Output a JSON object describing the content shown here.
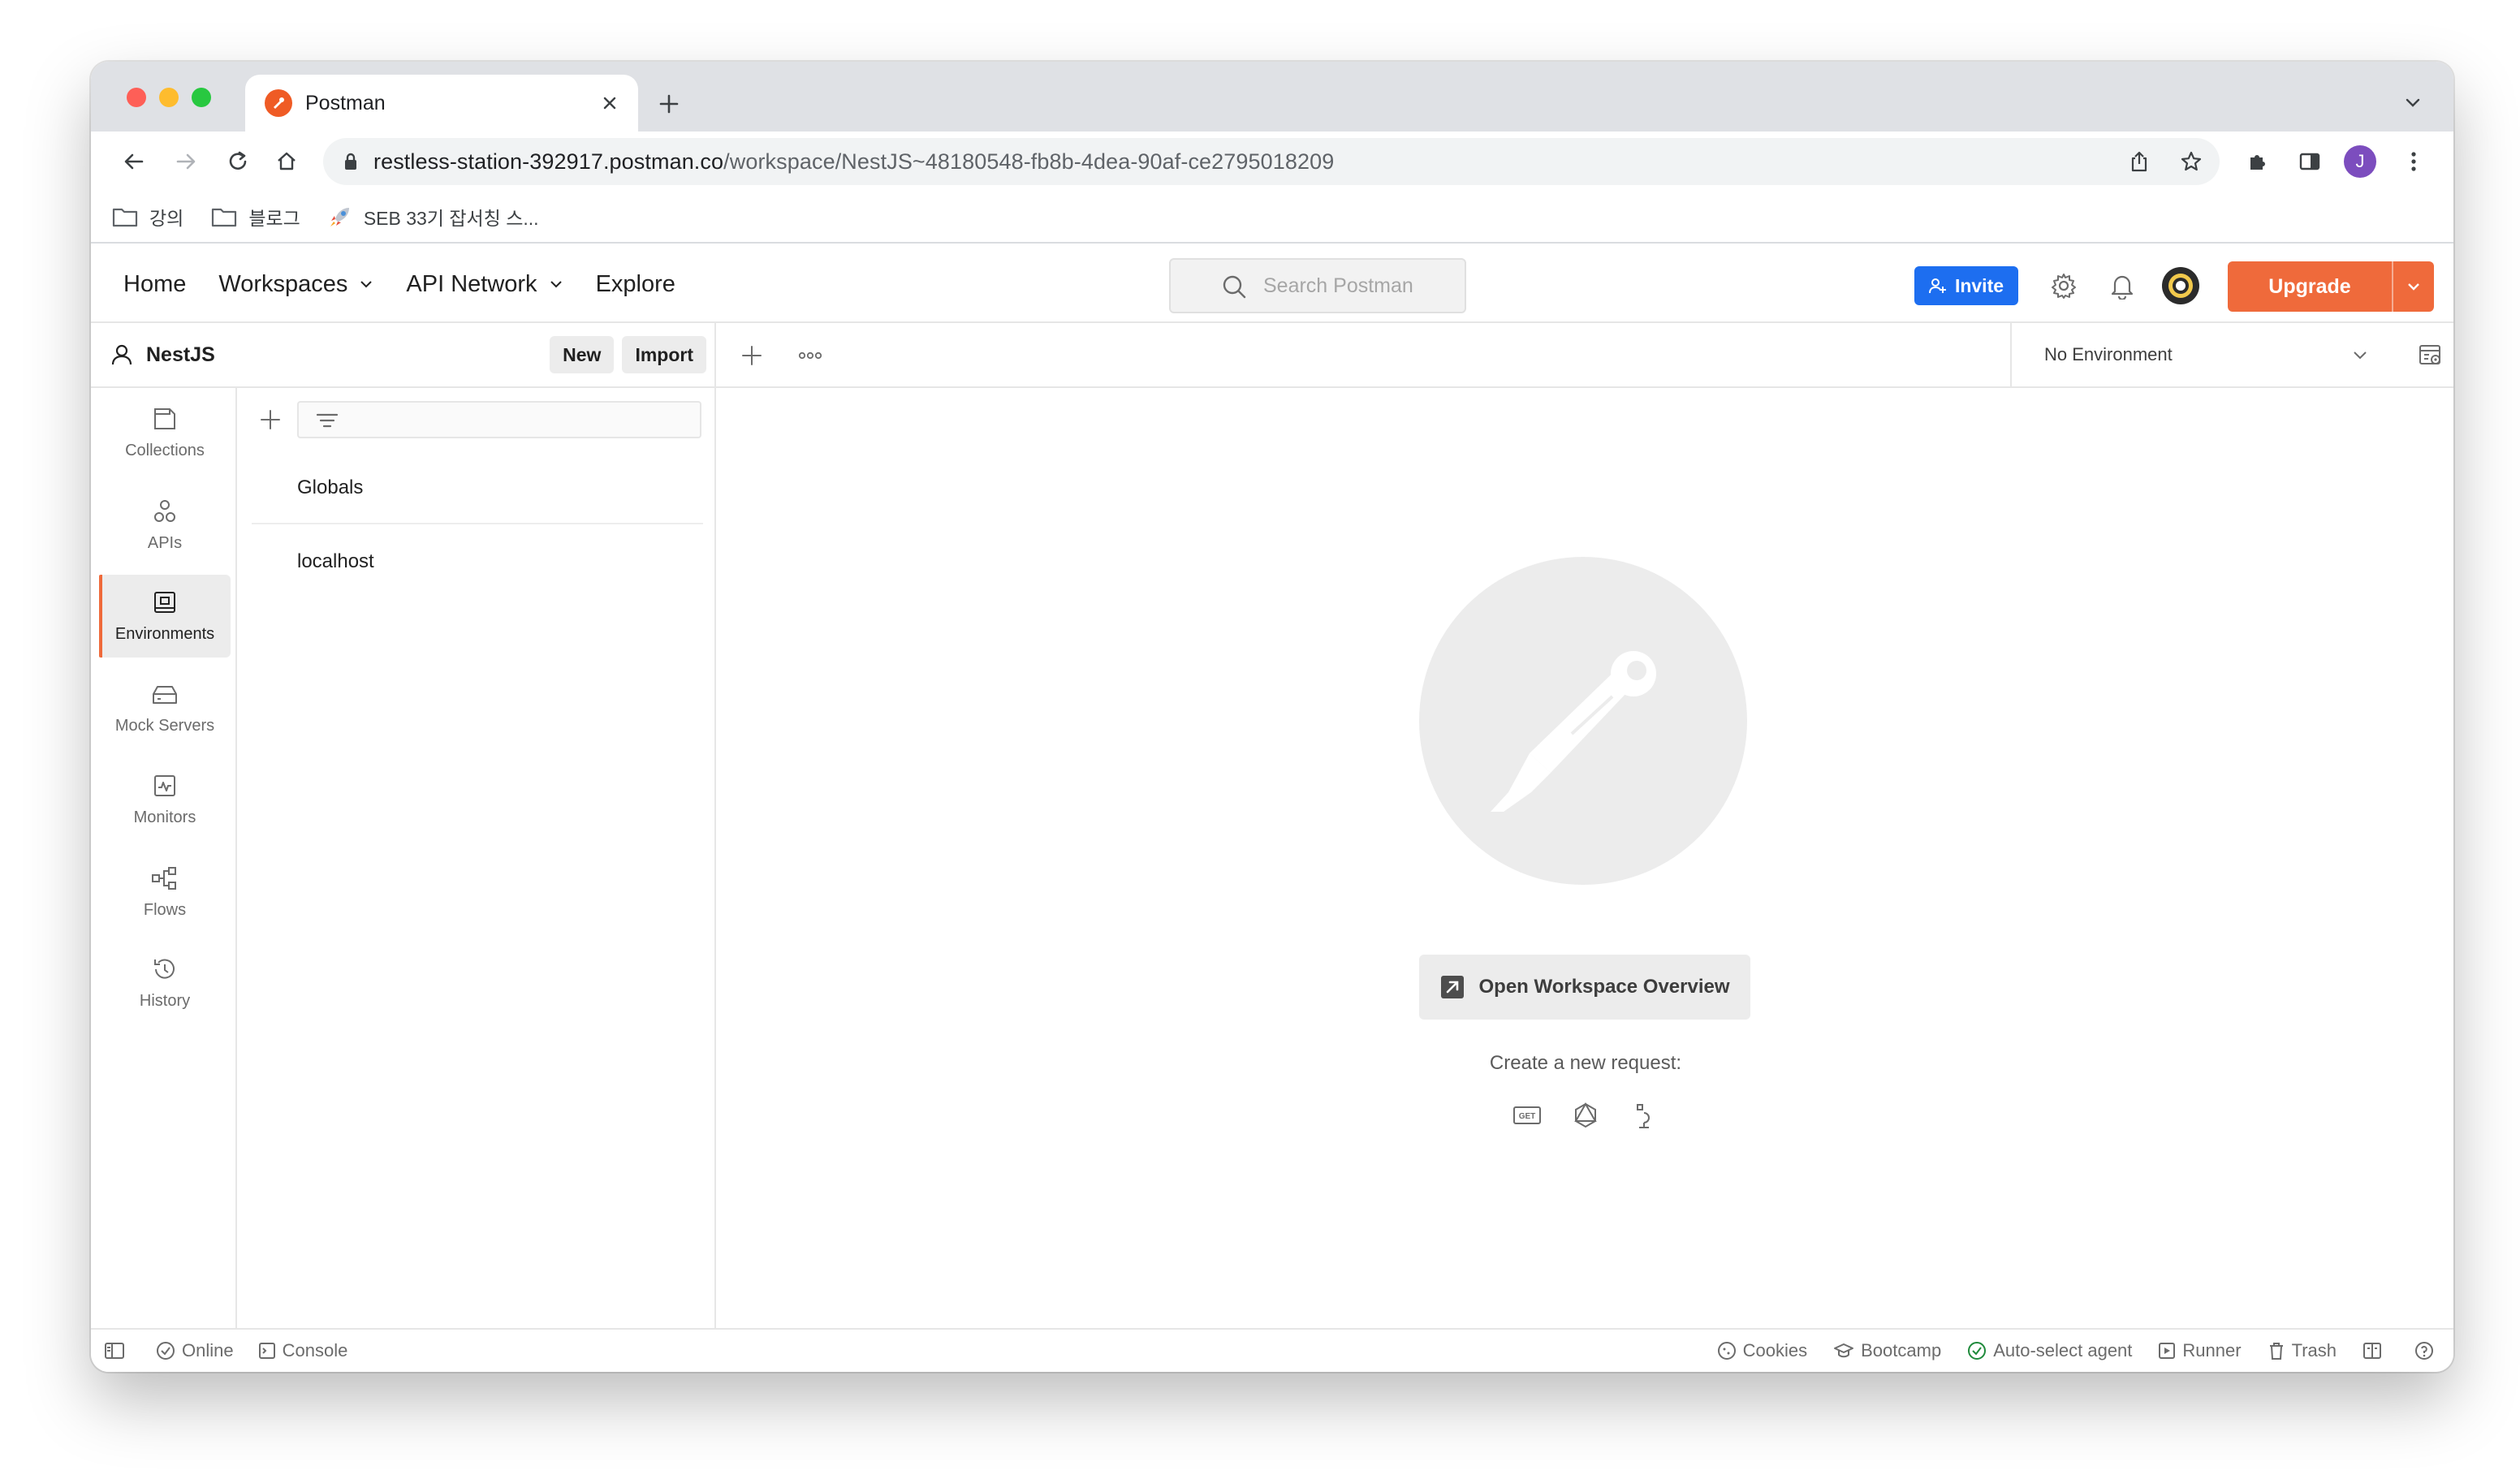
{
  "browser": {
    "tab_title": "Postman",
    "url_host": "restless-station-392917.postman.co",
    "url_path": "/workspace/NestJS~48180548-fb8b-4dea-90af-ce2795018209",
    "profile_initial": "J",
    "bookmarks": [
      {
        "label": "강의",
        "icon": "folder-icon"
      },
      {
        "label": "블로그",
        "icon": "folder-icon"
      },
      {
        "label": "SEB 33기 잡서칭 스...",
        "icon": "rocket-icon"
      }
    ]
  },
  "header": {
    "nav": [
      "Home",
      "Workspaces",
      "API Network",
      "Explore"
    ],
    "search_placeholder": "Search Postman",
    "invite_label": "Invite",
    "upgrade_label": "Upgrade",
    "accent_color": "#ef6a3b",
    "invite_color": "#1d6ef0"
  },
  "workspace": {
    "name": "NestJS",
    "new_label": "New",
    "import_label": "Import"
  },
  "sidebar": {
    "items": [
      {
        "label": "Collections",
        "icon": "collections-icon",
        "active": false
      },
      {
        "label": "APIs",
        "icon": "apis-icon",
        "active": false
      },
      {
        "label": "Environments",
        "icon": "environments-icon",
        "active": true
      },
      {
        "label": "Mock Servers",
        "icon": "mock-servers-icon",
        "active": false
      },
      {
        "label": "Monitors",
        "icon": "monitors-icon",
        "active": false
      },
      {
        "label": "Flows",
        "icon": "flows-icon",
        "active": false
      },
      {
        "label": "History",
        "icon": "history-icon",
        "active": false
      }
    ]
  },
  "environments": {
    "items": [
      "Globals",
      "localhost"
    ]
  },
  "tabs_bar": {
    "environment_select": "No Environment"
  },
  "main": {
    "overview_button": "Open Workspace Overview",
    "create_label": "Create a new request:",
    "create_icons": [
      "http-get-icon",
      "graphql-icon",
      "grpc-icon"
    ]
  },
  "status_bar": {
    "left": [
      "Online",
      "Console"
    ],
    "right": [
      "Cookies",
      "Bootcamp",
      "Auto-select agent",
      "Runner",
      "Trash"
    ]
  }
}
